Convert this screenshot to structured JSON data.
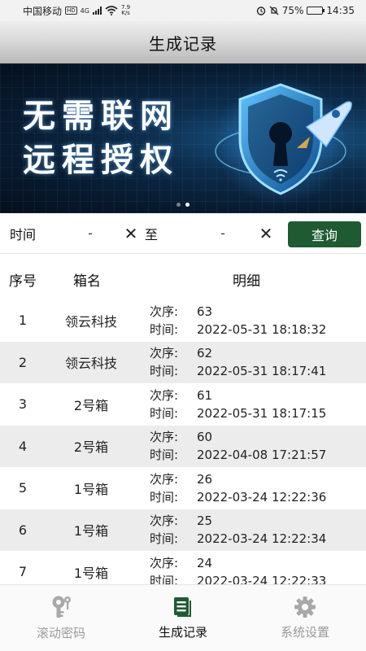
{
  "status_bar": {
    "carrier": "中国移动",
    "hd": "HD",
    "signal_type": "4G",
    "speed_value": "7.9",
    "speed_unit": "K/s",
    "battery": "75%",
    "battery_fraction": 0.75,
    "time": "14:35"
  },
  "title": "生成记录",
  "banner": {
    "line1": "无需联网",
    "line2": "远程授权",
    "slides": 2,
    "active_slide": 1
  },
  "filter": {
    "time_label": "时间",
    "start_value": "-",
    "to_label": "至",
    "end_value": "-",
    "query_label": "查询"
  },
  "table": {
    "headers": {
      "no": "序号",
      "name": "箱名",
      "detail": "明细"
    },
    "order_label": "次序:",
    "time_label": "时间:",
    "rows": [
      {
        "no": "1",
        "name": "领云科技",
        "order": "63",
        "time": "2022-05-31 18:18:32"
      },
      {
        "no": "2",
        "name": "领云科技",
        "order": "62",
        "time": "2022-05-31 18:17:41"
      },
      {
        "no": "3",
        "name": "2号箱",
        "order": "61",
        "time": "2022-05-31 18:17:15"
      },
      {
        "no": "4",
        "name": "2号箱",
        "order": "60",
        "time": "2022-04-08 17:21:57"
      },
      {
        "no": "5",
        "name": "1号箱",
        "order": "26",
        "time": "2022-03-24 12:22:36"
      },
      {
        "no": "6",
        "name": "1号箱",
        "order": "25",
        "time": "2022-03-24 12:22:34"
      },
      {
        "no": "7",
        "name": "1号箱",
        "order": "24",
        "time": "2022-03-24 12:22:33"
      }
    ]
  },
  "nav": {
    "items": [
      {
        "label": "滚动密码",
        "icon": "key-icon",
        "active": false
      },
      {
        "label": "生成记录",
        "icon": "record-list-icon",
        "active": true
      },
      {
        "label": "系统设置",
        "icon": "gear-icon",
        "active": false
      }
    ]
  },
  "colors": {
    "accent": "#1f5a32",
    "inactive": "#9a9a9a",
    "row_alt": "#ececec"
  }
}
